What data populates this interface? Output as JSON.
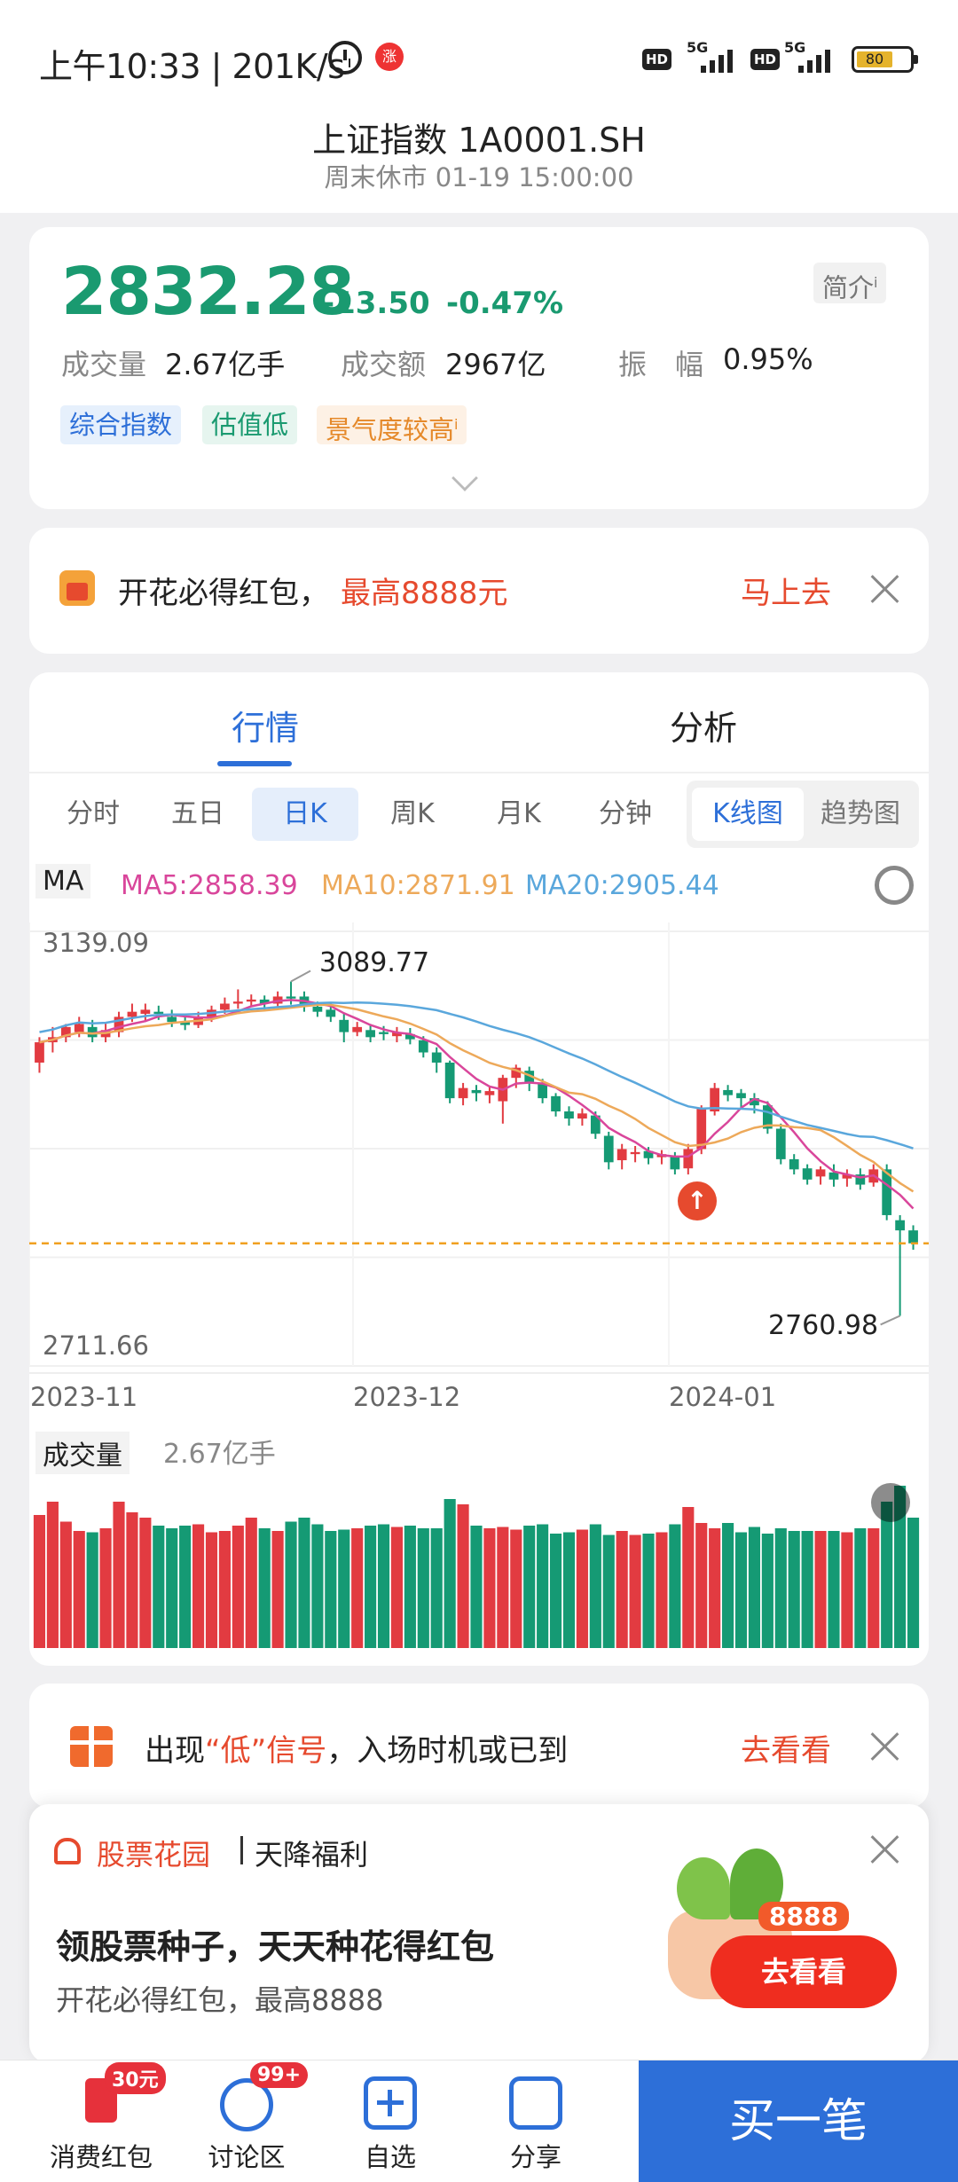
{
  "status_bar": {
    "time": "上午10:33 | 201K/s",
    "network1": "5G",
    "network2": "5G",
    "hd": "HD",
    "battery": "80"
  },
  "header": {
    "title": "上证指数 1A0001.SH",
    "subtitle": "周末休市 01-19 15:00:00"
  },
  "quote": {
    "price": "2832.28",
    "change": "-13.50",
    "change_pct": "-0.47%",
    "intro_button": "简介",
    "volume_label": "成交量",
    "volume_value": "2.67亿手",
    "amount_label": "成交额",
    "amount_value": "2967亿",
    "amplitude_label": "振　幅",
    "amplitude_value": "0.95%",
    "tags": [
      "综合指数",
      "估值低",
      "景气度较高"
    ]
  },
  "promo_banner": {
    "text": "开花必得红包，",
    "highlight": "最高8888元",
    "action": "马上去"
  },
  "main_tabs": [
    "行情",
    "分析"
  ],
  "period_tabs": [
    "分时",
    "五日",
    "日K",
    "周K",
    "月K",
    "分钟"
  ],
  "chart_mode": [
    "K线图",
    "趋势图"
  ],
  "ma_legend": {
    "label": "MA",
    "ma5": "MA5:2858.39",
    "ma10": "MA10:2871.91",
    "ma20": "MA20:2905.44"
  },
  "axis": {
    "high": "3139.09",
    "low": "2711.66",
    "peak_label": "3089.77",
    "trough_label": "2760.98",
    "dates": [
      "2023-11",
      "2023-12",
      "2024-01"
    ]
  },
  "volume_panel": {
    "label": "成交量",
    "value": "2.67亿手"
  },
  "signal_banner": {
    "text_prefix": "出现",
    "highlight": "“低”信号",
    "text_suffix": "，入场时机或已到",
    "action": "去看看"
  },
  "popup": {
    "brand": "股票花园",
    "brand_sub": "天降福利",
    "title": "领股票种子，天天种花得红包",
    "subtitle": "开花必得红包，最高8888",
    "amount_tag": "8888",
    "button": "去看看"
  },
  "bottom_nav": [
    {
      "label": "消费红包",
      "badge": "30元"
    },
    {
      "label": "讨论区",
      "badge": "99+"
    },
    {
      "label": "自选",
      "badge": ""
    },
    {
      "label": "分享",
      "badge": ""
    }
  ],
  "buy_button": "买一笔",
  "colors": {
    "up": "#e23b41",
    "down": "#159a74",
    "ma5": "#d9469b",
    "ma10": "#eda95a",
    "ma20": "#5aa7dc",
    "accent": "#2d6fd8"
  },
  "chart_data": {
    "type": "candlestick",
    "ylim": [
      2711.66,
      3139.09
    ],
    "xlabels": [
      "2023-11",
      "2023-12",
      "2024-01"
    ],
    "candles": [
      [
        3010,
        3030,
        3000,
        3035
      ],
      [
        3030,
        3035,
        3020,
        3045
      ],
      [
        3035,
        3045,
        3030,
        3048
      ],
      [
        3040,
        3048,
        3035,
        3055
      ],
      [
        3045,
        3035,
        3030,
        3052
      ],
      [
        3035,
        3042,
        3030,
        3050
      ],
      [
        3040,
        3055,
        3035,
        3060
      ],
      [
        3055,
        3060,
        3050,
        3068
      ],
      [
        3058,
        3062,
        3050,
        3068
      ],
      [
        3060,
        3058,
        3052,
        3066
      ],
      [
        3055,
        3050,
        3045,
        3062
      ],
      [
        3050,
        3047,
        3042,
        3055
      ],
      [
        3047,
        3055,
        3044,
        3060
      ],
      [
        3055,
        3062,
        3050,
        3066
      ],
      [
        3062,
        3068,
        3058,
        3074
      ],
      [
        3068,
        3070,
        3063,
        3082
      ],
      [
        3070,
        3072,
        3065,
        3077
      ],
      [
        3072,
        3068,
        3062,
        3076
      ],
      [
        3068,
        3075,
        3064,
        3080
      ],
      [
        3075,
        3073,
        3067,
        3089.77
      ],
      [
        3075,
        3065,
        3060,
        3080
      ],
      [
        3065,
        3060,
        3055,
        3070
      ],
      [
        3062,
        3055,
        3050,
        3068
      ],
      [
        3052,
        3040,
        3030,
        3058
      ],
      [
        3040,
        3045,
        3036,
        3050
      ],
      [
        3042,
        3035,
        3030,
        3048
      ],
      [
        3040,
        3038,
        3032,
        3046
      ],
      [
        3036,
        3040,
        3030,
        3045
      ],
      [
        3038,
        3033,
        3028,
        3044
      ],
      [
        3032,
        3020,
        3015,
        3036
      ],
      [
        3020,
        3010,
        3000,
        3025
      ],
      [
        3010,
        2975,
        2970,
        3012
      ],
      [
        2975,
        2985,
        2968,
        2990
      ],
      [
        2983,
        2980,
        2972,
        2988
      ],
      [
        2978,
        2982,
        2970,
        2986
      ],
      [
        2972,
        2995,
        2950,
        2998
      ],
      [
        2995,
        3005,
        2985,
        3008
      ],
      [
        3002,
        2990,
        2982,
        3006
      ],
      [
        2990,
        2975,
        2970,
        2994
      ],
      [
        2977,
        2962,
        2957,
        2980
      ],
      [
        2962,
        2955,
        2948,
        2967
      ],
      [
        2955,
        2960,
        2948,
        2965
      ],
      [
        2958,
        2940,
        2935,
        2962
      ],
      [
        2938,
        2912,
        2905,
        2942
      ],
      [
        2914,
        2925,
        2905,
        2930
      ],
      [
        2920,
        2922,
        2912,
        2928
      ],
      [
        2923,
        2916,
        2910,
        2927
      ],
      [
        2917,
        2920,
        2910,
        2924
      ],
      [
        2918,
        2905,
        2900,
        2922
      ],
      [
        2906,
        2925,
        2900,
        2930
      ],
      [
        2925,
        2965,
        2920,
        2968
      ],
      [
        2962,
        2985,
        2958,
        2990
      ],
      [
        2983,
        2978,
        2972,
        2988
      ],
      [
        2980,
        2975,
        2966,
        2984
      ],
      [
        2975,
        2968,
        2960,
        2980
      ],
      [
        2968,
        2945,
        2940,
        2972
      ],
      [
        2945,
        2915,
        2910,
        2950
      ],
      [
        2915,
        2905,
        2900,
        2920
      ],
      [
        2906,
        2895,
        2890,
        2910
      ],
      [
        2898,
        2905,
        2890,
        2908
      ],
      [
        2902,
        2895,
        2888,
        2910
      ],
      [
        2896,
        2900,
        2888,
        2905
      ],
      [
        2900,
        2890,
        2885,
        2906
      ],
      [
        2892,
        2905,
        2888,
        2910
      ],
      [
        2905,
        2860,
        2855,
        2910
      ],
      [
        2855,
        2845,
        2760.98,
        2860
      ],
      [
        2845,
        2832.28,
        2826,
        2850
      ]
    ],
    "volume_label": "成交量 2.67亿手"
  }
}
